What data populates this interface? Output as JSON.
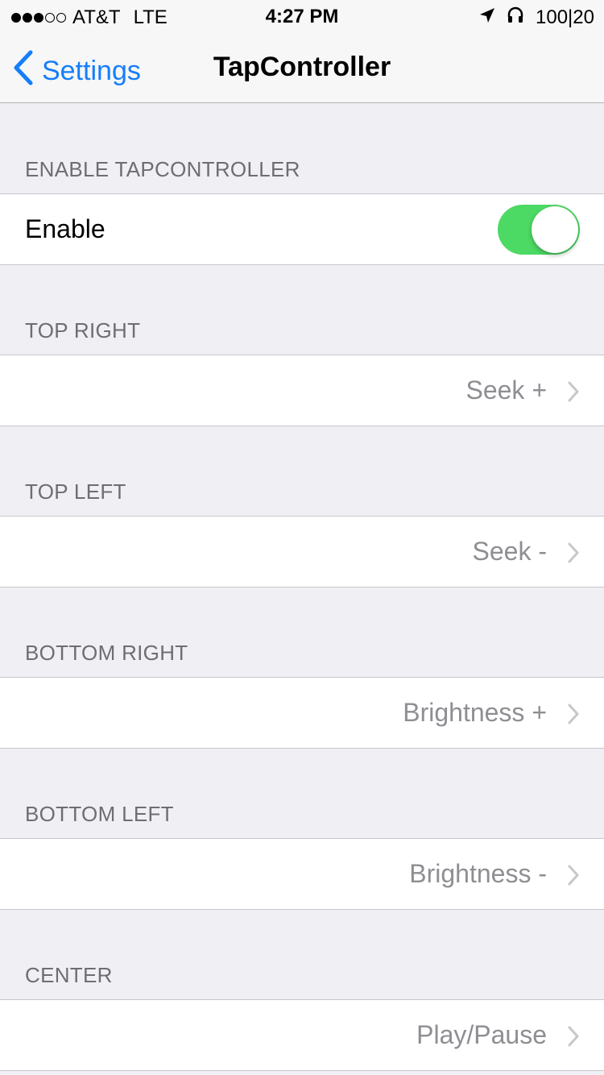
{
  "status_bar": {
    "carrier": "AT&T",
    "network": "LTE",
    "time": "4:27 PM",
    "battery_text": "100|20",
    "signal_dots_filled": 3,
    "signal_dots_total": 5
  },
  "nav": {
    "back_label": "Settings",
    "title": "TapController"
  },
  "sections": [
    {
      "header": "ENABLE TAPCONTROLLER",
      "label": "Enable",
      "toggle_on": true
    },
    {
      "header": "TOP RIGHT",
      "value": "Seek +"
    },
    {
      "header": "TOP LEFT",
      "value": "Seek -"
    },
    {
      "header": "BOTTOM RIGHT",
      "value": "Brightness +"
    },
    {
      "header": "BOTTOM LEFT",
      "value": "Brightness -"
    },
    {
      "header": "CENTER",
      "value": "Play/Pause"
    }
  ],
  "colors": {
    "accent": "#157efb",
    "toggle_on": "#4cd964",
    "background": "#efeff4"
  }
}
